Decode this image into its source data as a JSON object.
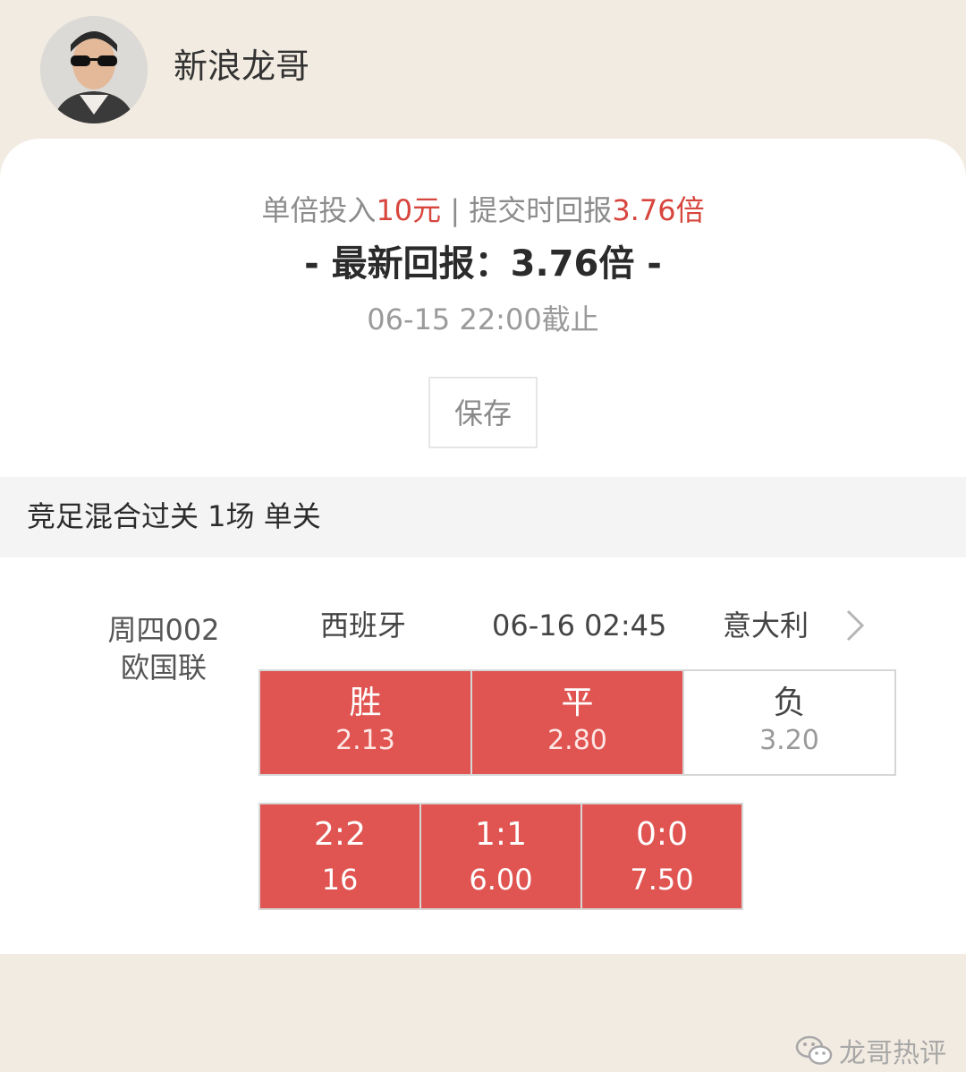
{
  "header": {
    "username": "新浪龙哥"
  },
  "summary": {
    "stake_prefix": "单倍投入",
    "stake_amount": "10元",
    "separator": " | ",
    "submit_prefix": "提交时回报",
    "submit_return": "3.76倍",
    "latest_return": "- 最新回报：3.76倍 -",
    "deadline": "06-15 22:00截止",
    "save_label": "保存"
  },
  "section": {
    "title": "竞足混合过关 1场 单关"
  },
  "match": {
    "id_line1": "周四002",
    "id_line2": "欧国联",
    "home": "西班牙",
    "time": "06-16 02:45",
    "away": "意大利",
    "odds": [
      {
        "label": "胜",
        "value": "2.13",
        "selected": true
      },
      {
        "label": "平",
        "value": "2.80",
        "selected": true
      },
      {
        "label": "负",
        "value": "3.20",
        "selected": false
      }
    ],
    "scores": [
      {
        "label": "2:2",
        "value": "16",
        "selected": true
      },
      {
        "label": "1:1",
        "value": "6.00",
        "selected": true
      },
      {
        "label": "0:0",
        "value": "7.50",
        "selected": true
      }
    ]
  },
  "watermark": {
    "text": "龙哥热评",
    "icon": "wechat-icon"
  },
  "colors": {
    "accent_red": "#e05552",
    "text_red": "#d7453d",
    "page_bg": "#f2ebe1"
  }
}
